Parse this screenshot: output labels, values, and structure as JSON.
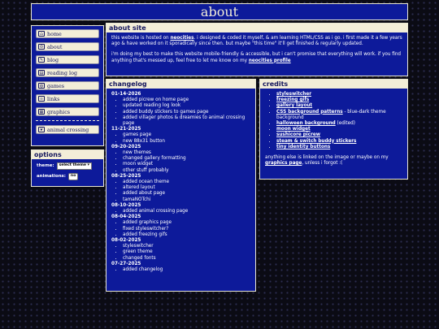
{
  "header": {
    "title": "about"
  },
  "nav": {
    "items": [
      {
        "label": "home",
        "icon": "home-icon"
      },
      {
        "label": "about",
        "icon": "person-icon"
      },
      {
        "label": "blog",
        "icon": "pencil-icon"
      },
      {
        "label": "reading log",
        "icon": "book-icon"
      },
      {
        "label": "games",
        "icon": "gamepad-icon"
      },
      {
        "label": "links",
        "icon": "link-icon"
      },
      {
        "label": "graphics",
        "icon": "image-icon"
      }
    ],
    "extra": {
      "label": "animal crossing",
      "icon": "leaf-icon"
    }
  },
  "options": {
    "title": "options",
    "theme_label": "theme:",
    "theme_value": "select theme",
    "animations_label": "animations:",
    "animations_value": "no"
  },
  "about": {
    "title": "about site",
    "p1_a": "this website is hosted on ",
    "p1_link": "neocities",
    "p1_b": ". i designed & coded it myself, & am learning HTML/CSS as i go. i first made it a few years ago & have worked on it sporadically since then. but maybe \"this time\" it'll get finished & regularly updated.",
    "p2_a": "i'm doing my best to make this website mobile-friendly & accessible, but i can't promise that everything will work. if you find anything that's messed up, feel free to let me know on my ",
    "p2_link": "neocities profile"
  },
  "changelog": {
    "title": "changelog",
    "entries": [
      {
        "date": "01-14-2026",
        "items": [
          "added picrew on home page",
          "updated reading log look",
          "added buddy stickers to games page",
          "added villager photos & dreamies to animal crossing page"
        ]
      },
      {
        "date": "11-21-2025",
        "items": [
          "games page",
          "new 88x31 button"
        ]
      },
      {
        "date": "09-20-2025",
        "items": [
          "new themes",
          "changed gallery formatting",
          "moon widget",
          "other stuff probably"
        ]
      },
      {
        "date": "08-25-2025",
        "items": [
          "added ocean theme",
          "altered layout",
          "added about page",
          "tamaNOTchi"
        ]
      },
      {
        "date": "08-10-2025",
        "items": [
          "added animal crossing page"
        ]
      },
      {
        "date": "08-04-2025",
        "items": [
          "added graphics page",
          "fixed styleswitcher?",
          "added freezing gifs"
        ]
      },
      {
        "date": "08-02-2025",
        "items": [
          "styleswitcher",
          "green theme",
          "changed fonts"
        ]
      },
      {
        "date": "07-27-2025",
        "items": [
          "added changelog"
        ]
      }
    ]
  },
  "credits": {
    "title": "credits",
    "items": [
      {
        "link": "styleswitcher",
        "note": ""
      },
      {
        "link": "freezing gifs",
        "note": ""
      },
      {
        "link": "gallery layout",
        "note": ""
      },
      {
        "link": "CSS background patterns",
        "note": " - blue-dark theme background"
      },
      {
        "link": "halloween background",
        "note": " (edited)"
      },
      {
        "link": "moon widget",
        "note": ""
      },
      {
        "link": "sushicore picrew",
        "note": ""
      },
      {
        "link": "steam & switch buddy stickers",
        "note": ""
      },
      {
        "link": "tiny identity buttons",
        "note": ""
      }
    ],
    "footer_a": "anything else is linked on the image or maybe on my ",
    "footer_link": "graphics page",
    "footer_b": ", unless i forgot :("
  },
  "colors": {
    "panel": "#0d1a9a",
    "header_bg": "#f3eed8",
    "page_bg": "#0b0b14"
  }
}
